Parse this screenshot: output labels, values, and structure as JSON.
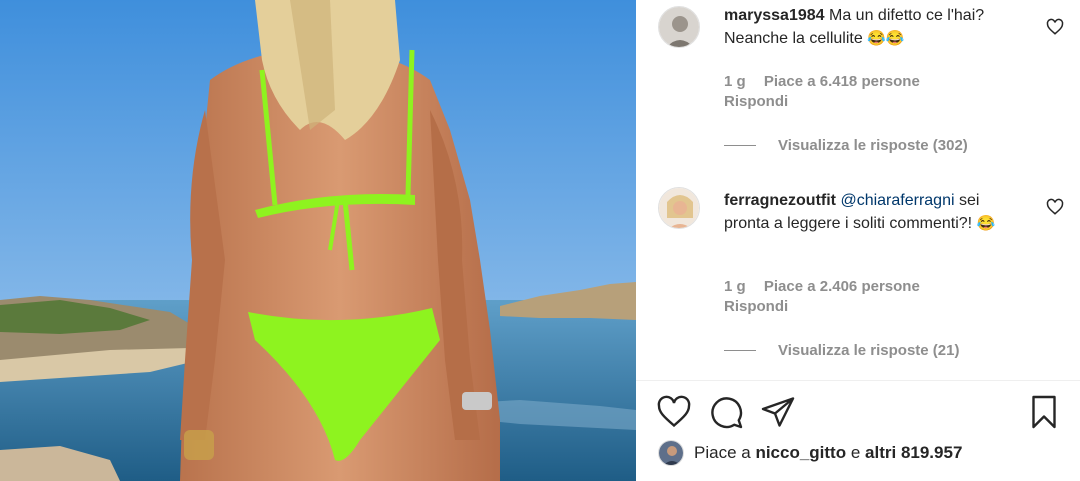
{
  "post": {
    "actions": {
      "like": "heart-icon",
      "comment": "comment-icon",
      "share": "paper-plane-icon",
      "save": "bookmark-icon"
    },
    "likes": {
      "prefix": "Piace a",
      "user": "nicco_gitto",
      "connector": "e",
      "others": "altri 819.957"
    }
  },
  "comments": [
    {
      "username": "maryssa1984",
      "text": "Ma un difetto ce l'hai? Neanche la cellulite",
      "emojis": "😂😂",
      "age": "1 g",
      "likes": "Piace a 6.418 persone",
      "reply": "Rispondi",
      "view_replies": "Visualizza le risposte (302)"
    },
    {
      "username": "ferragnezoutfit",
      "mention": "@chiaraferragni",
      "text": "sei pronta a leggere i soliti commenti?!",
      "emojis": "😂",
      "age": "1 g",
      "likes": "Piace a 2.406 persone",
      "reply": "Rispondi",
      "view_replies": "Visualizza le risposte (21)"
    }
  ],
  "colors": {
    "text": "#262626",
    "muted": "#8e8e8e",
    "mention": "#00376b",
    "bikini": "#8ef31f",
    "sky": "#4a94d8",
    "sea": "#2f6f9e"
  }
}
